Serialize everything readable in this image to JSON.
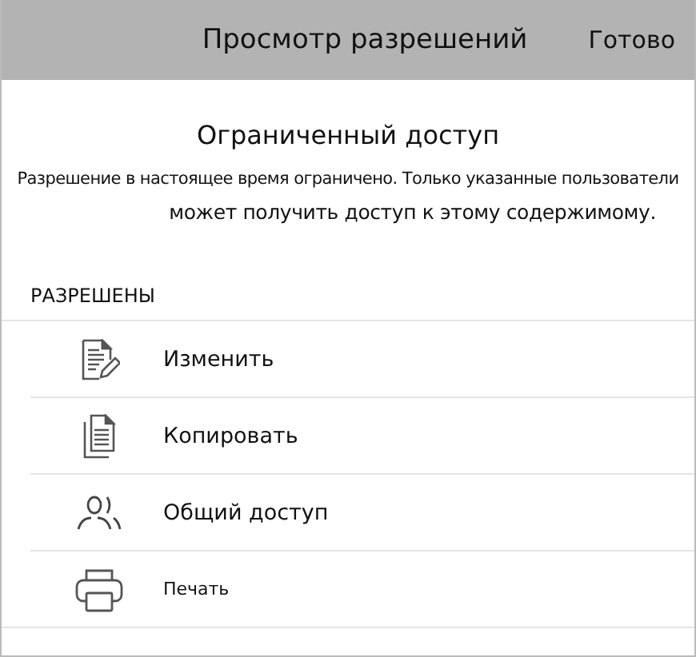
{
  "header": {
    "title": "Просмотр разрешений",
    "done_button": "Готово"
  },
  "notice": {
    "title": "Ограниченный доступ",
    "lines": [
      "Разрешение в настоящее время ограничено. Только указанные пользователи",
      "может получить доступ к этому содержимому."
    ]
  },
  "section": {
    "title": "РАЗРЕШЕНЫ"
  },
  "permissions": [
    {
      "kind": "edit",
      "label": "Изменить"
    },
    {
      "kind": "copy",
      "label": "Копировать"
    },
    {
      "kind": "share",
      "label": "Общий доступ"
    },
    {
      "kind": "print",
      "label": "Печать"
    }
  ]
}
